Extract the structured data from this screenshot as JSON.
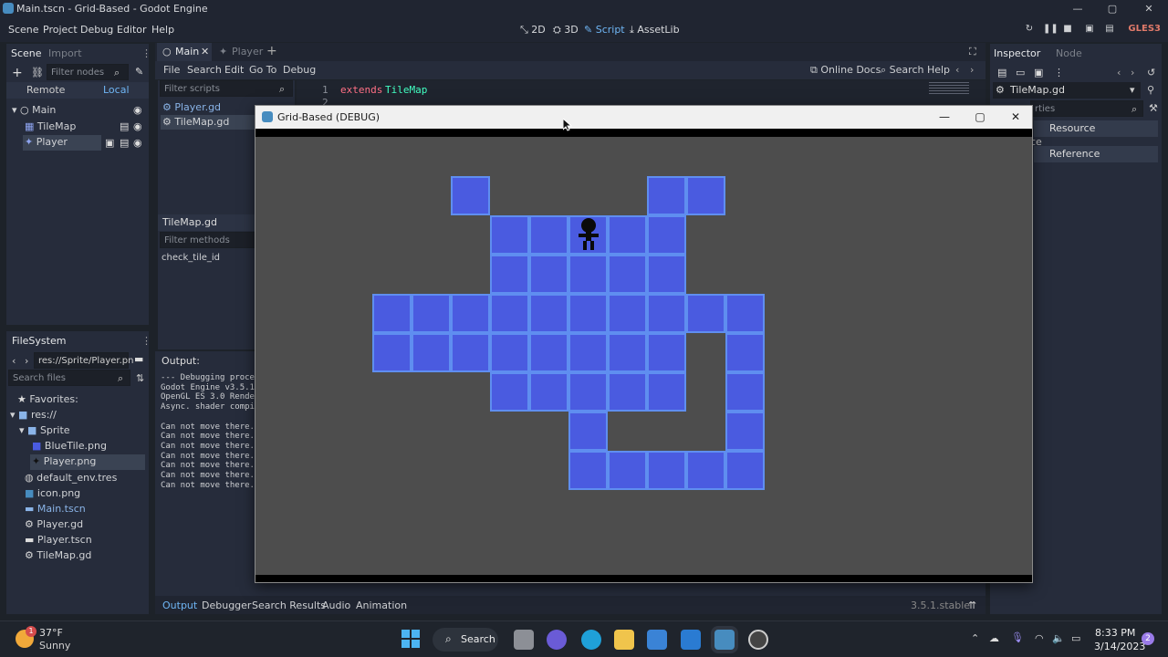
{
  "window": {
    "title": "Main.tscn - Grid-Based - Godot Engine",
    "min": "—",
    "max": "▢",
    "close": "✕"
  },
  "menubar": {
    "items": [
      "Scene",
      "Project",
      "Debug",
      "Editor",
      "Help"
    ],
    "modes": [
      "2D",
      "3D",
      "Script",
      "AssetLib"
    ],
    "renderer": "GLES3"
  },
  "scene_dock": {
    "tabs": [
      "Scene",
      "Import"
    ],
    "filter_placeholder": "Filter nodes",
    "remote": "Remote",
    "local": "Local",
    "nodes": [
      "Main",
      "TileMap",
      "Player"
    ]
  },
  "filesystem_dock": {
    "title": "FileSystem",
    "path": "res://Sprite/Player.pn",
    "search_placeholder": "Search files",
    "favorites": "Favorites:",
    "items": [
      "res://",
      "Sprite",
      "BlueTile.png",
      "Player.png",
      "default_env.tres",
      "icon.png",
      "Main.tscn",
      "Player.gd",
      "Player.tscn",
      "TileMap.gd"
    ]
  },
  "editor_tabs": [
    "Main",
    "Player"
  ],
  "script_menu": [
    "File",
    "Search",
    "Edit",
    "Go To",
    "Debug"
  ],
  "script_help": {
    "online_docs": "Online Docs",
    "search_help": "Search Help"
  },
  "script_list": {
    "filter_placeholder": "Filter scripts",
    "scripts": [
      "Player.gd",
      "TileMap.gd"
    ],
    "current": "TileMap.gd",
    "filter_methods_placeholder": "Filter methods",
    "methods": [
      "check_tile_id"
    ]
  },
  "code": {
    "line1_num": "1",
    "line2_num": "2",
    "kw": "extends",
    "cls": "TileMap"
  },
  "output": {
    "title": "Output:",
    "lines": [
      "--- Debugging proce",
      "Godot Engine v3.5.1",
      "OpenGL ES 3.0 Rende",
      "Async. shader compi",
      "",
      "Can not move there.",
      "Can not move there.",
      "Can not move there.",
      "Can not move there.",
      "Can not move there.",
      "Can not move there.",
      "Can not move there."
    ]
  },
  "bottom_tabs": [
    "Output",
    "Debugger",
    "Search Results",
    "Audio",
    "Animation"
  ],
  "version": "3.5.1.stable",
  "inspector": {
    "tabs": [
      "Inspector",
      "Node"
    ],
    "resource": "TileMap.gd",
    "filter_placeholder": "rties",
    "section_fragment": "ce",
    "resource_btn": "Resource",
    "reference_btn": "Reference"
  },
  "game_window": {
    "title": "Grid-Based (DEBUG)",
    "min": "—",
    "max": "▢",
    "close": "✕"
  },
  "taskbar": {
    "temp": "37°F",
    "weather": "Sunny",
    "weather_badge": "1",
    "search": "Search",
    "time": "8:33 PM",
    "date": "3/14/2023",
    "notif": "2"
  },
  "colors": {
    "tile": "#4a5be0",
    "tile_border": "#5f8ef0",
    "accent": "#6fb6f5"
  }
}
